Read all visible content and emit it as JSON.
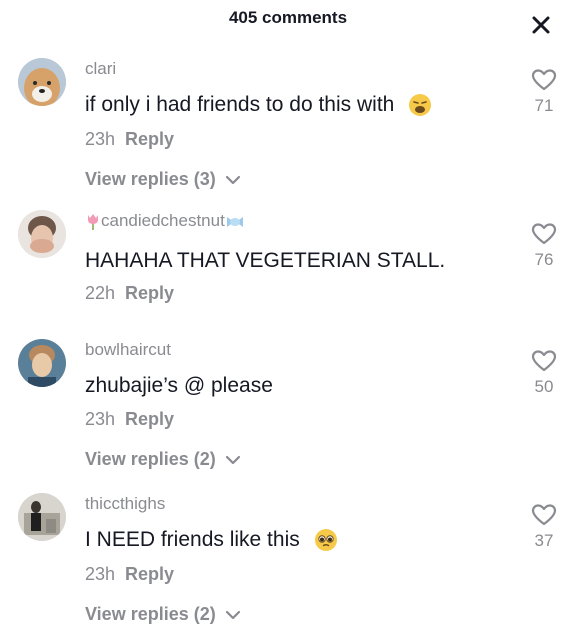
{
  "header": {
    "title": "405 comments"
  },
  "comments": [
    {
      "username": "clari",
      "text": "if only i had friends to do this with",
      "time": "23h",
      "reply_label": "Reply",
      "likes": "71",
      "view_replies": "View replies (3)"
    },
    {
      "username": "candiedchestnut",
      "text": "HAHAHA THAT VEGETERIAN STALL.",
      "time": "22h",
      "reply_label": "Reply",
      "likes": "76"
    },
    {
      "username": "bowlhaircut",
      "text": "zhubajie’s @ please",
      "time": "23h",
      "reply_label": "Reply",
      "likes": "50",
      "view_replies": "View replies (2)"
    },
    {
      "username": "thiccthighs",
      "text": "I NEED friends like this",
      "time": "23h",
      "reply_label": "Reply",
      "likes": "37",
      "view_replies": "View replies (2)"
    }
  ],
  "icons": {
    "close": "close-icon",
    "like": "heart-outline-icon",
    "chevron": "chevron-down-icon"
  },
  "colors": {
    "text": "#161823",
    "secondary": "#8a8b91"
  }
}
